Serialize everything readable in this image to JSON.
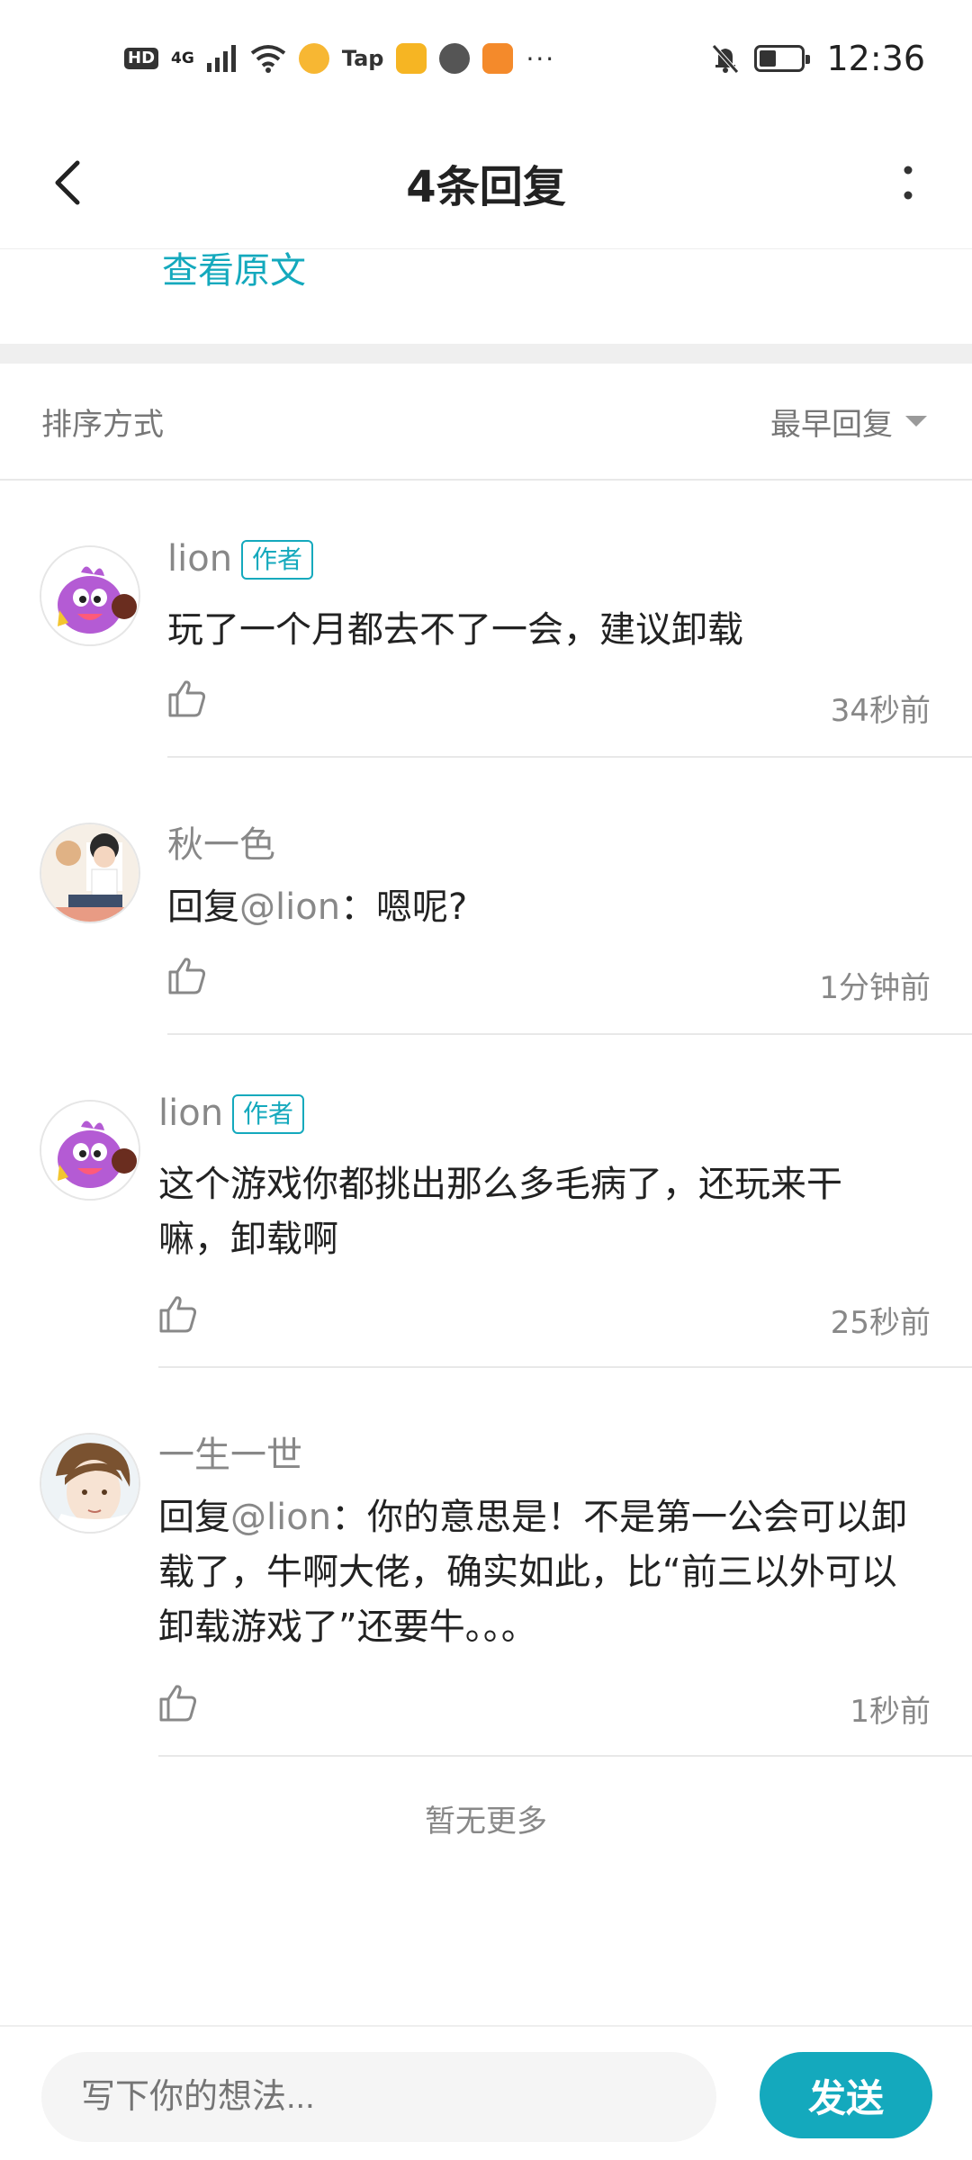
{
  "status_bar": {
    "left_icons": [
      "hd-icon",
      "4g-signal-icon",
      "wifi-icon",
      "duck-app-icon",
      "tap-app-icon",
      "mail-app-icon",
      "ball-app-icon",
      "video-app-icon",
      "more-dots-icon"
    ],
    "hd_label": "HD",
    "network_label": "4G",
    "tap_label": "Tap",
    "more_label": "···",
    "time": "12:36"
  },
  "header": {
    "title": "4条回复"
  },
  "view_original": "查看原文",
  "sort": {
    "label": "排序方式",
    "value": "最早回复"
  },
  "comments": [
    {
      "username": "lion",
      "badge": "作者",
      "text": "玩了一个月都去不了一会，建议卸载",
      "time": "34秒前"
    },
    {
      "username": "秋一色",
      "badge": "",
      "reply_prefix": "回复",
      "mention": "@lion",
      "text": "：嗯呢?",
      "time": "1分钟前"
    },
    {
      "username": "lion",
      "badge": "作者",
      "text": "这个游戏你都挑出那么多毛病了，还玩来干嘛，卸载啊",
      "time": "25秒前"
    },
    {
      "username": "一生一世",
      "badge": "",
      "reply_prefix": "回复",
      "mention": "@lion",
      "text": "：你的意思是！不是第一公会可以卸载了，牛啊大佬，确实如此，比“前三以外可以卸载游戏了”还要牛。。。",
      "time": "1秒前"
    }
  ],
  "no_more": "暂无更多",
  "input": {
    "placeholder": "写下你的想法..."
  },
  "send_label": "发送",
  "colors": {
    "accent": "#14a9bd",
    "muted_text": "#888888",
    "section_gap": "#efefef"
  }
}
